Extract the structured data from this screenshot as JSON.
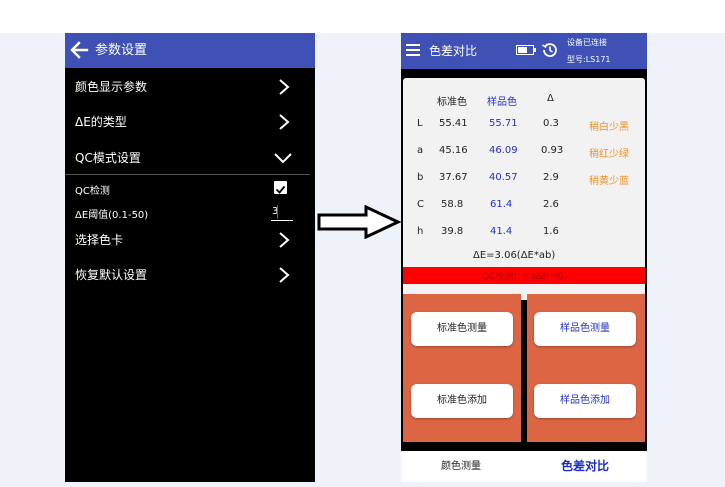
{
  "settings": {
    "title": "参数设置",
    "items": [
      {
        "label": "颜色显示参数"
      },
      {
        "label": "ΔE的类型"
      },
      {
        "label": "QC模式设置"
      }
    ],
    "qc_check_label": "QC检测",
    "threshold_label": "ΔE阈值(0.1-50)",
    "threshold_value": "3",
    "more_items": [
      {
        "label": "选择色卡"
      },
      {
        "label": "恢复默认设置"
      }
    ]
  },
  "compare": {
    "title": "色差对比",
    "status": "设备已连接",
    "model": "型号:LS171",
    "headers": {
      "standard": "标准色",
      "sample": "样品色",
      "delta": "Δ"
    },
    "rows": [
      {
        "channel": "L",
        "standard": "55.41",
        "sample": "55.71",
        "delta": "0.3",
        "note": "稍白少黑"
      },
      {
        "channel": "a",
        "standard": "45.16",
        "sample": "46.09",
        "delta": "0.93",
        "note": "稍红少绿"
      },
      {
        "channel": "b",
        "standard": "37.67",
        "sample": "40.57",
        "delta": "2.9",
        "note": "稍黄少蓝"
      },
      {
        "channel": "C",
        "standard": "58.8",
        "sample": "61.4",
        "delta": "2.6",
        "note": ""
      },
      {
        "channel": "h",
        "standard": "39.8",
        "sample": "41.4",
        "delta": "1.6",
        "note": ""
      }
    ],
    "delta_e": "ΔE=3.06(ΔE*ab)",
    "qc_result": "QC检测：>3ΔE  NG",
    "buttons": {
      "std_measure": "标准色测量",
      "sample_measure": "样品色测量",
      "std_add": "标准色添加",
      "sample_add": "样品色添加"
    },
    "nav": {
      "measure": "颜色测量",
      "compare": "色差对比"
    }
  },
  "colors": {
    "appbar": "#3f51b5",
    "accent_blue": "#2430c4",
    "orange": "#ee8f26",
    "alert_red": "#ff0000",
    "button_area": "#dc6544"
  }
}
